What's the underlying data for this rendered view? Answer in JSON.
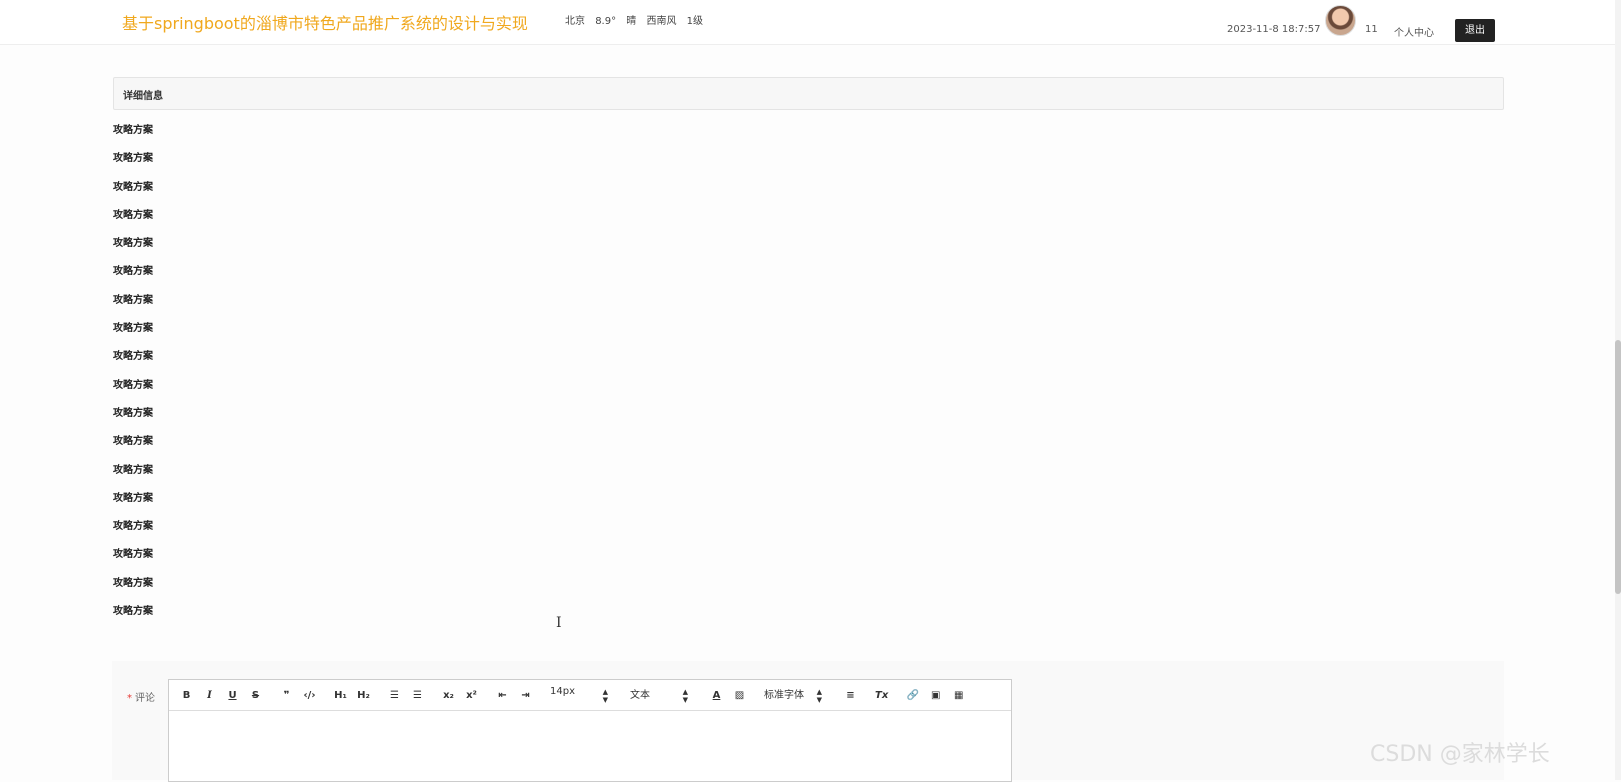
{
  "header": {
    "site_title": "基于springboot的淄博市特色产品推广系统的设计与实现",
    "weather": {
      "city": "北京",
      "temperature": "8.9°",
      "condition": "晴",
      "wind": "西南风",
      "level": "1级"
    },
    "datetime": "2023-11-8 18:7:57",
    "username": "11",
    "personal_center": "个人中心",
    "logout": "退出"
  },
  "detail": {
    "section_title": "详细信息",
    "lines": [
      "攻略方案",
      "攻略方案",
      "攻略方案",
      "攻略方案",
      "攻略方案",
      "攻略方案",
      "攻略方案",
      "攻略方案",
      "攻略方案",
      "攻略方案",
      "攻略方案",
      "攻略方案",
      "攻略方案",
      "攻略方案",
      "攻略方案",
      "攻略方案",
      "攻略方案",
      "攻略方案"
    ]
  },
  "comment": {
    "required_mark": "*",
    "label": "评论",
    "toolbar": {
      "bold": "B",
      "italic": "I",
      "underline": "U",
      "strike": "S",
      "quote": "❞",
      "code": "‹/›",
      "h1": "H₁",
      "h2": "H₂",
      "ordered_list": "☰",
      "bullet_list": "☰",
      "subscript": "x₂",
      "superscript": "x²",
      "indent_left": "⇤",
      "indent_right": "⇥",
      "font_size": "14px",
      "text_type": "文本",
      "font_color": "A",
      "background_color": "▨",
      "font_family": "标准字体",
      "align": "≡",
      "clear_format": "Tx",
      "link": "🔗",
      "image": "▣",
      "video": "▦"
    }
  },
  "watermark": "CSDN @家林学长"
}
